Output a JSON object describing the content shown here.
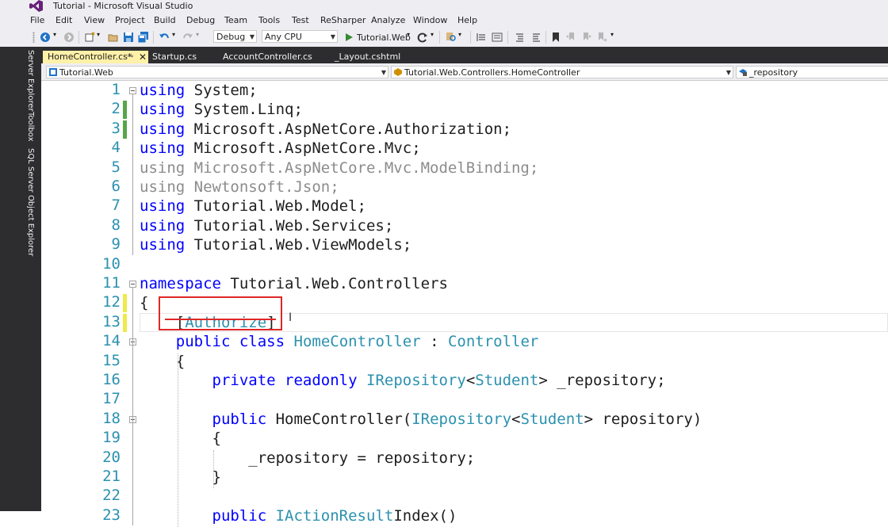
{
  "window": {
    "title": "Tutorial - Microsoft Visual Studio"
  },
  "menu": [
    "File",
    "Edit",
    "View",
    "Project",
    "Build",
    "Debug",
    "Team",
    "Tools",
    "Test",
    "ReSharper",
    "Analyze",
    "Window",
    "Help"
  ],
  "toolbar": {
    "config": "Debug",
    "platform": "Any CPU",
    "run_target": "Tutorial.Web"
  },
  "side_tabs": [
    "Server Explorer",
    "Toolbox",
    "SQL Server Object Explorer"
  ],
  "tabs": [
    {
      "label": "HomeController.cs*",
      "active": true
    },
    {
      "label": "Startup.cs",
      "active": false
    },
    {
      "label": "AccountController.cs",
      "active": false
    },
    {
      "label": "_Layout.cshtml",
      "active": false
    }
  ],
  "nav": {
    "project": "Tutorial.Web",
    "type": "Tutorial.Web.Controllers.HomeController",
    "member": "_repository"
  },
  "code": {
    "lines": [
      {
        "n": "1",
        "segs": [
          [
            "kw",
            "using"
          ],
          [
            "",
            "System;"
          ]
        ]
      },
      {
        "n": "2",
        "segs": [
          [
            "kw",
            "using"
          ],
          [
            "",
            "System.Linq;"
          ]
        ]
      },
      {
        "n": "3",
        "segs": [
          [
            "kw",
            "using"
          ],
          [
            "",
            "Microsoft.AspNetCore.Authorization;"
          ]
        ]
      },
      {
        "n": "4",
        "segs": [
          [
            "kw",
            "using"
          ],
          [
            "",
            "Microsoft.AspNetCore.Mvc;"
          ]
        ]
      },
      {
        "n": "5",
        "segs": [
          [
            "dim",
            "using Microsoft.AspNetCore.Mvc.ModelBinding;"
          ]
        ]
      },
      {
        "n": "6",
        "segs": [
          [
            "dim",
            "using Newtonsoft.Json;"
          ]
        ]
      },
      {
        "n": "7",
        "segs": [
          [
            "kw",
            "using"
          ],
          [
            "",
            "Tutorial.Web.Model;"
          ]
        ]
      },
      {
        "n": "8",
        "segs": [
          [
            "kw",
            "using"
          ],
          [
            "",
            "Tutorial.Web.Services;"
          ]
        ]
      },
      {
        "n": "9",
        "segs": [
          [
            "kw",
            "using"
          ],
          [
            "",
            "Tutorial.Web.ViewModels;"
          ]
        ]
      },
      {
        "n": "10",
        "segs": []
      },
      {
        "n": "11",
        "segs": [
          [
            "kw",
            "namespace"
          ],
          [
            "",
            "Tutorial.Web.Controllers"
          ]
        ]
      },
      {
        "n": "12",
        "segs": [
          [
            "",
            "{"
          ]
        ]
      },
      {
        "n": "13",
        "segs": [
          [
            "",
            "    ["
          ],
          [
            "ty",
            "Authorize"
          ],
          [
            "",
            "]"
          ]
        ]
      },
      {
        "n": "14",
        "segs": [
          [
            "",
            "    "
          ],
          [
            "kw",
            "public class"
          ],
          [
            "ty",
            "HomeController"
          ],
          [
            "",
            " : "
          ],
          [
            "ty",
            "Controller"
          ]
        ]
      },
      {
        "n": "15",
        "segs": [
          [
            "",
            "    {"
          ]
        ]
      },
      {
        "n": "16",
        "segs": [
          [
            "",
            "        "
          ],
          [
            "kw",
            "private readonly"
          ],
          [
            "ty",
            "IRepository"
          ],
          [
            "",
            "<"
          ],
          [
            "ty",
            "Student"
          ],
          [
            "",
            "> _repository;"
          ]
        ]
      },
      {
        "n": "17",
        "segs": []
      },
      {
        "n": "18",
        "segs": [
          [
            "",
            "        "
          ],
          [
            "kw",
            "public"
          ],
          [
            "",
            "HomeController("
          ],
          [
            "ty",
            "IRepository"
          ],
          [
            "",
            "<"
          ],
          [
            "ty",
            "Student"
          ],
          [
            "",
            "> repository)"
          ]
        ]
      },
      {
        "n": "19",
        "segs": [
          [
            "",
            "        {"
          ]
        ]
      },
      {
        "n": "20",
        "segs": [
          [
            "",
            "            _repository = repository;"
          ]
        ]
      },
      {
        "n": "21",
        "segs": [
          [
            "",
            "        }"
          ]
        ]
      },
      {
        "n": "22",
        "segs": []
      },
      {
        "n": "23",
        "segs": [
          [
            "",
            "        "
          ],
          [
            "kw",
            "public"
          ],
          [
            "ty",
            "IActionResult"
          ],
          [
            "",
            "Index()"
          ]
        ]
      }
    ]
  },
  "colors": {
    "keyword": "#0000ff",
    "type": "#2b91af",
    "line_number": "#2b91af",
    "dimmed": "#8c8c8c",
    "saved_change": "#57a64a",
    "unsaved_change": "#efe94a",
    "annotation": "#e02727",
    "active_tab": "#fff1a8"
  }
}
